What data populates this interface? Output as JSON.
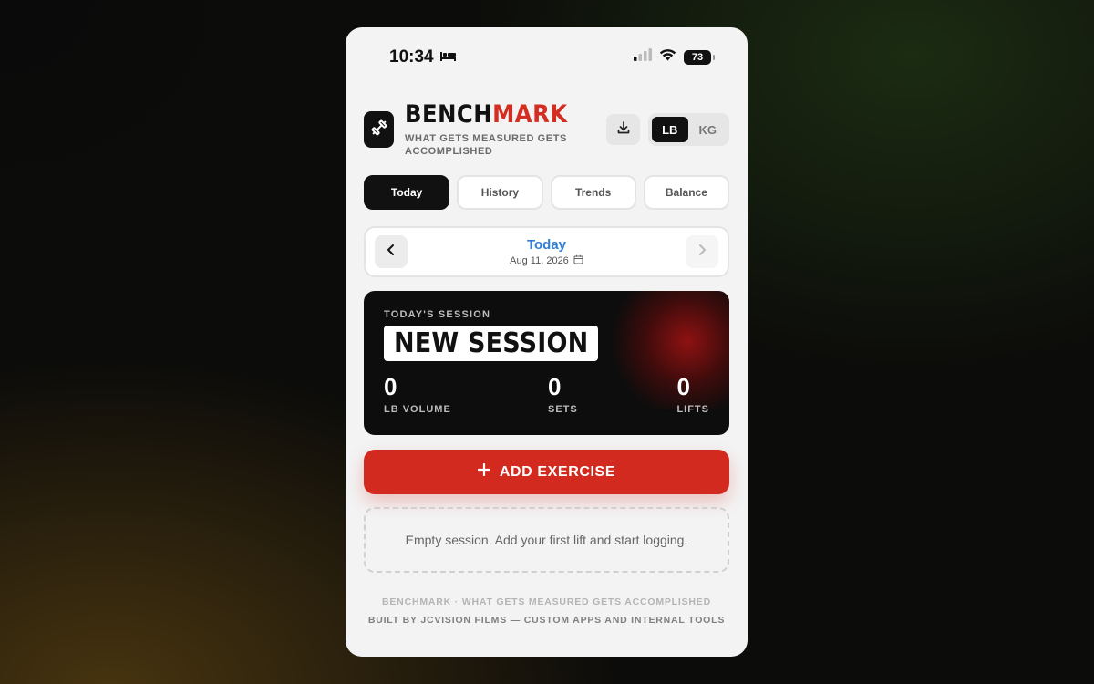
{
  "status": {
    "time": "10:34",
    "battery": "73"
  },
  "header": {
    "brand_main": "BENCH",
    "brand_accent": "MARK",
    "tagline": "WHAT GETS MEASURED GETS ACCOMPLISHED",
    "units": [
      "LB",
      "KG"
    ],
    "selected_unit": "LB"
  },
  "tabs": [
    {
      "label": "Today",
      "active": true
    },
    {
      "label": "History",
      "active": false
    },
    {
      "label": "Trends",
      "active": false
    },
    {
      "label": "Balance",
      "active": false
    }
  ],
  "date_nav": {
    "title": "Today",
    "date": "Aug 11, 2026"
  },
  "session": {
    "label": "TODAY'S SESSION",
    "name": "NEW SESSION",
    "stats": [
      {
        "value": "0",
        "label": "LB VOLUME"
      },
      {
        "value": "0",
        "label": "SETS"
      },
      {
        "value": "0",
        "label": "LIFTS"
      }
    ]
  },
  "actions": {
    "add_exercise": "ADD EXERCISE"
  },
  "empty_state": "Empty session. Add your first lift and start logging.",
  "footer": {
    "line1": "BENCHMARK · WHAT GETS MEASURED GETS ACCOMPLISHED",
    "line2": "BUILT BY JCVISION FILMS — CUSTOM APPS AND INTERNAL TOOLS"
  },
  "colors": {
    "accent_red": "#d22a1e",
    "date_blue": "#2f7fd6",
    "dark": "#111111"
  }
}
